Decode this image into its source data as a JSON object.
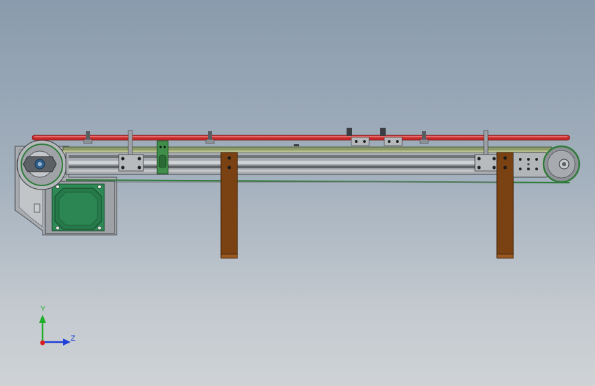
{
  "view": {
    "background_top": "#8a9bad",
    "background_bottom": "#cfd3d6"
  },
  "model": {
    "belt_color": "#2f7a3a",
    "rail_color": "#c72a2a",
    "leg_color": "#7a4212",
    "motor_color": "#1f7a4a",
    "frame_color": "#b8babc",
    "deck_color": "#8d9a6a"
  },
  "triad": {
    "y_label": "Y",
    "z_label": "Z",
    "y_color": "#1fae2a",
    "z_color": "#1f3fd6",
    "origin_color": "#d81e1e"
  }
}
